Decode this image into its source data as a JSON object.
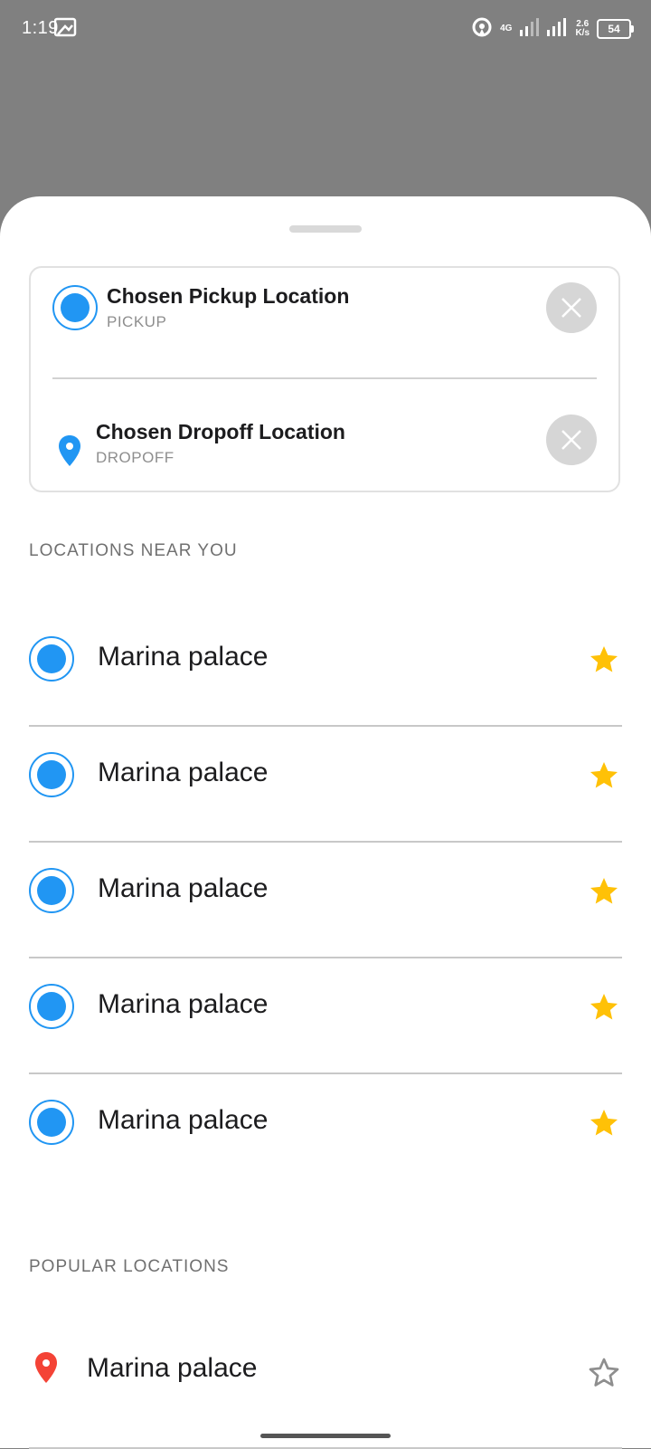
{
  "status_bar": {
    "time": "1:19",
    "network_type": "4G",
    "speed_value": "2.6",
    "speed_unit": "K/s",
    "battery": "54"
  },
  "route": {
    "pickup": {
      "title": "Chosen Pickup Location",
      "subtitle": "PICKUP"
    },
    "dropoff": {
      "title": "Chosen Dropoff Location",
      "subtitle": "DROPOFF"
    }
  },
  "nearby": {
    "heading": "LOCATIONS NEAR YOU",
    "items": [
      {
        "name": "Marina palace",
        "favorite": true
      },
      {
        "name": "Marina palace",
        "favorite": true
      },
      {
        "name": "Marina palace",
        "favorite": true
      },
      {
        "name": "Marina palace",
        "favorite": true
      },
      {
        "name": "Marina palace",
        "favorite": true
      }
    ]
  },
  "popular": {
    "heading": "POPULAR LOCATIONS",
    "items": [
      {
        "name": "Marina palace",
        "favorite": false
      }
    ]
  },
  "colors": {
    "accent": "#2196f3",
    "star_active": "#ffc107",
    "pin_popular": "#f44336",
    "overlay": "#808080"
  },
  "icons": {
    "pickup": "radio-dot-icon",
    "dropoff": "location-pin-icon",
    "clear": "close-icon",
    "favorite": "star-icon",
    "popular_pin": "location-pin-icon"
  }
}
